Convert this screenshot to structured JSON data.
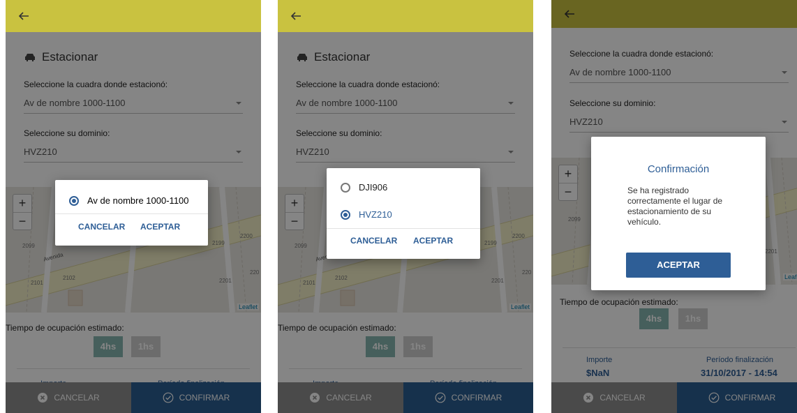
{
  "form": {
    "heading": "Estacionar",
    "cuadra_label": "Seleccione la cuadra donde estacionó:",
    "cuadra_value": "Av de nombre 1000-1100",
    "dominio_label": "Seleccione su dominio:",
    "dominio_value": "HVZ210"
  },
  "map": {
    "zoom_in": "+",
    "zoom_out": "−",
    "attribution": "Leaflet",
    "street_name": "Avenida",
    "numbers": [
      "2099",
      "2199",
      "2200",
      "2101",
      "2102",
      "2201",
      "220"
    ]
  },
  "time": {
    "label": "Tiempo de ocupación estimado:",
    "chip_1": "4hs",
    "chip_2": "1hs"
  },
  "summary": {
    "importe_label": "Importe",
    "importe_value": "$NaN",
    "periodo_label": "Período finalización",
    "periodo_value": "31/10/2017 - 14:54"
  },
  "bottom": {
    "cancel": "CANCELAR",
    "confirm": "CONFIRMAR"
  },
  "dialog1": {
    "option": "Av de nombre 1000-1100",
    "cancel": "CANCELAR",
    "accept": "ACEPTAR"
  },
  "dialog2": {
    "option_1": "DJI906",
    "option_2": "HVZ210",
    "cancel": "CANCELAR",
    "accept": "ACEPTAR"
  },
  "dialog3": {
    "title": "Confirmación",
    "body": "Se ha registrado correctamente el lugar de estacionamiento de su vehículo.",
    "accept": "ACEPTAR"
  },
  "colors": {
    "topbar": "#c9c240",
    "primary": "#2e5e96",
    "cancel_bar": "#8f8f8f",
    "chip_selected": "#86b6b0"
  }
}
